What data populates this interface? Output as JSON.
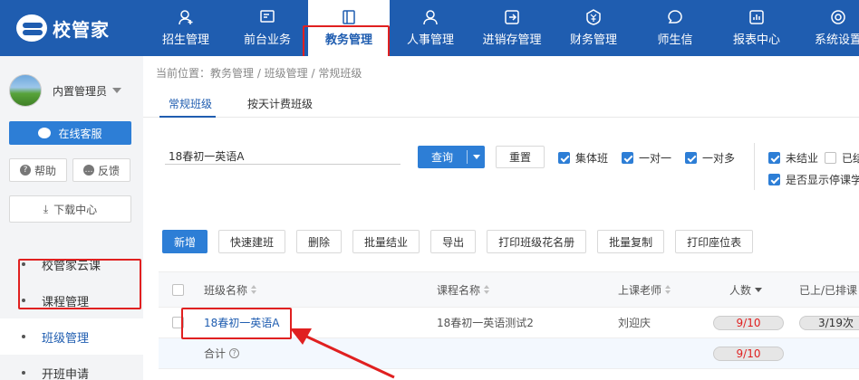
{
  "app": {
    "logo_text": "校管家"
  },
  "nav": {
    "items": [
      {
        "label": "招生管理",
        "icon": "user-plus-icon"
      },
      {
        "label": "前台业务",
        "icon": "monitor-icon"
      },
      {
        "label": "教务管理",
        "icon": "book-icon"
      },
      {
        "label": "人事管理",
        "icon": "person-icon"
      },
      {
        "label": "进销存管理",
        "icon": "exchange-icon"
      },
      {
        "label": "财务管理",
        "icon": "yen-shield-icon"
      },
      {
        "label": "师生信",
        "icon": "chat-icon"
      },
      {
        "label": "报表中心",
        "icon": "chart-icon"
      },
      {
        "label": "系统设置",
        "icon": "gear-icon"
      }
    ],
    "active_index": 2
  },
  "sidebar": {
    "user_name": "内置管理员",
    "service_label": "在线客服",
    "help_label": "帮助",
    "feedback_label": "反馈",
    "download_label": "下载中心",
    "menu": [
      {
        "label": "校管家云课"
      },
      {
        "label": "课程管理"
      },
      {
        "label": "班级管理"
      },
      {
        "label": "开班申请"
      }
    ]
  },
  "breadcrumb": "当前位置：教务管理 / 班级管理 / 常规班级",
  "tabs": [
    {
      "label": "常规班级"
    },
    {
      "label": "按天计费班级"
    }
  ],
  "filter": {
    "search_value": "18春初一英语A",
    "query_label": "查询",
    "reset_label": "重置",
    "checks": [
      {
        "label": "集体班",
        "checked": true
      },
      {
        "label": "一对一",
        "checked": true
      },
      {
        "label": "一对多",
        "checked": true
      },
      {
        "label": "未结业",
        "checked": true
      },
      {
        "label": "已结",
        "checked": false
      },
      {
        "label": "是否显示停课学",
        "checked": true
      }
    ]
  },
  "toolbar": {
    "new_label": "新增",
    "quick_label": "快速建班",
    "delete_label": "删除",
    "graduate_label": "批量结业",
    "export_label": "导出",
    "print_roster_label": "打印班级花名册",
    "copy_label": "批量复制",
    "print_seat_label": "打印座位表"
  },
  "table": {
    "headers": {
      "class_name": "班级名称",
      "course_name": "课程名称",
      "teacher": "上课老师",
      "count": "人数",
      "scheduled": "已上/已排课"
    },
    "rows": [
      {
        "class_name": "18春初一英语A",
        "course_name": "18春初一英语测试2",
        "teacher": "刘迎庆",
        "count": "9/10",
        "scheduled": "3/19次"
      }
    ],
    "total": {
      "label": "合计",
      "count": "9/10"
    }
  }
}
